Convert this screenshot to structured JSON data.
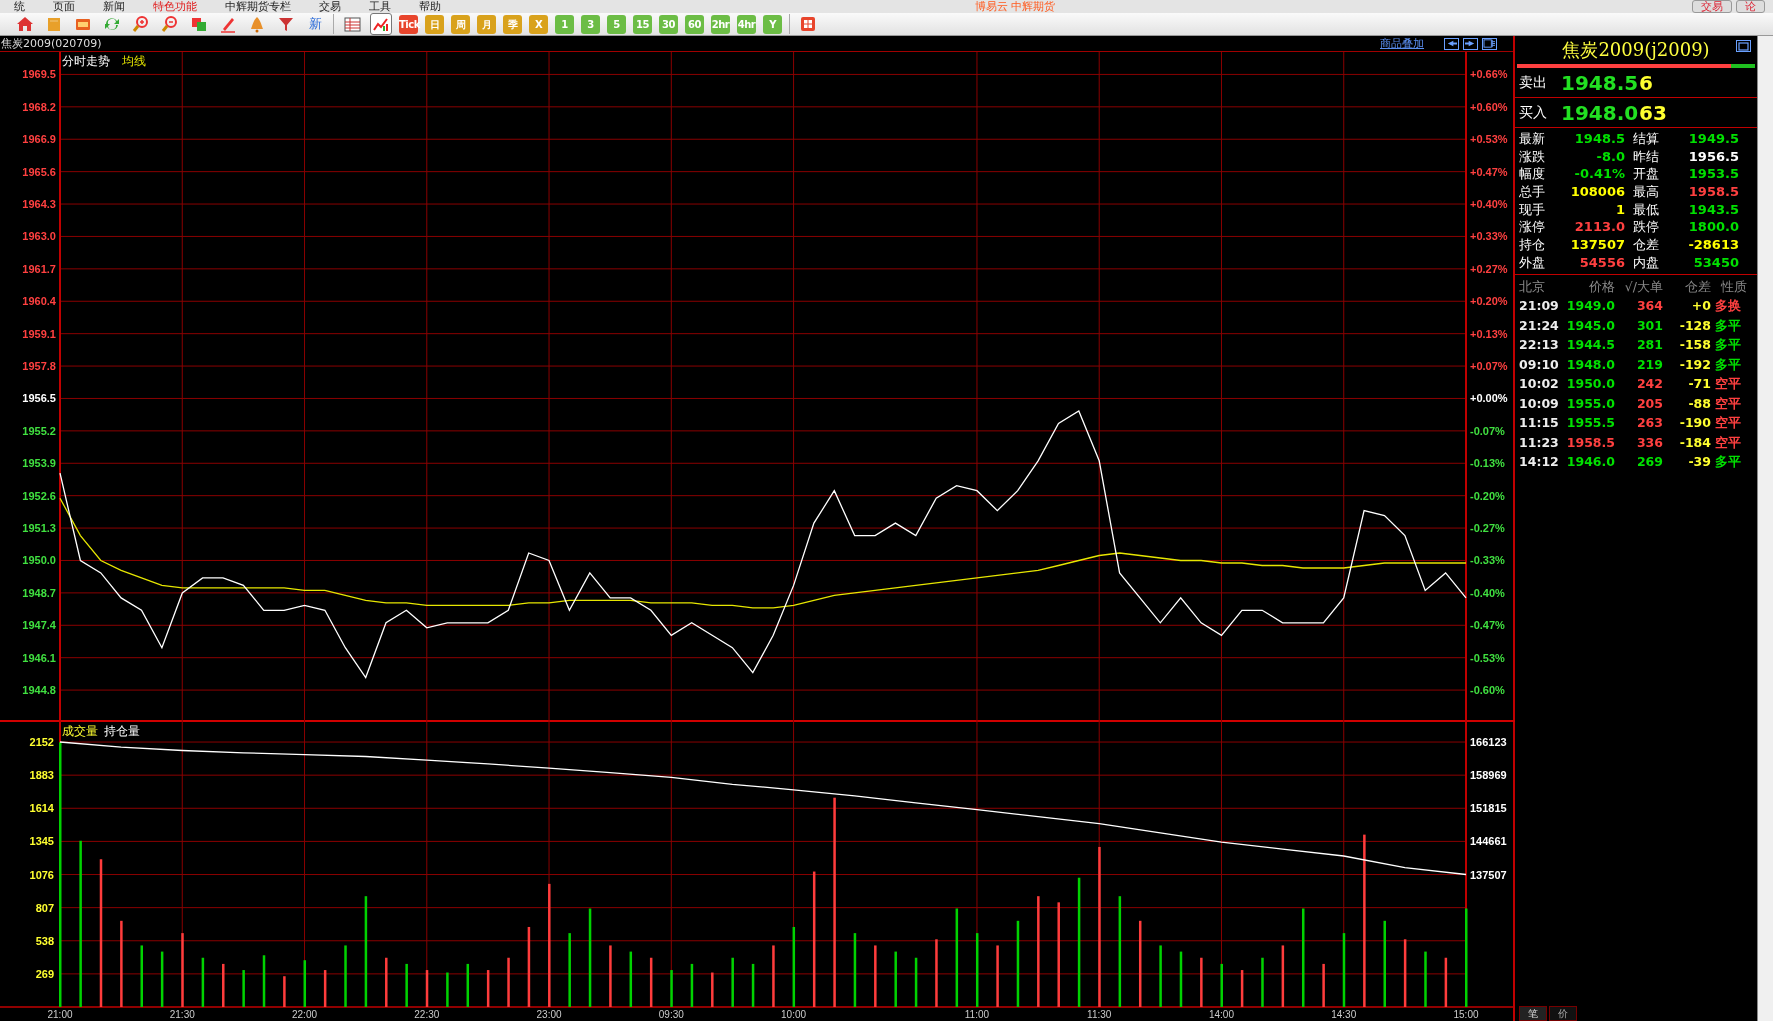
{
  "menu": {
    "items": [
      {
        "label": "统",
        "highlighted": false
      },
      {
        "label": "页面",
        "highlighted": false
      },
      {
        "label": "新闻",
        "highlighted": false
      },
      {
        "label": "特色功能",
        "highlighted": true
      },
      {
        "label": "中辉期货专栏",
        "highlighted": false
      },
      {
        "label": "交易",
        "highlighted": false
      },
      {
        "label": "工具",
        "highlighted": false
      },
      {
        "label": "帮助",
        "highlighted": false
      }
    ],
    "title": "博易云 中辉期货",
    "buttons": [
      "交易",
      "论"
    ]
  },
  "toolbar": {
    "icons": [
      {
        "selected": false
      },
      {
        "selected": false
      },
      {
        "selected": false
      },
      {
        "selected": false
      },
      {
        "selected": false
      },
      {
        "selected": false
      },
      {
        "selected": false
      },
      {
        "selected": false
      },
      {
        "selected": false
      },
      {
        "selected": false
      }
    ],
    "new_label": "新",
    "views": [
      {
        "selected": false
      },
      {
        "selected": true
      }
    ],
    "periods": [
      {
        "label": "Tick",
        "color": "#e8452c"
      },
      {
        "label": "日",
        "color": "#d9a21c"
      },
      {
        "label": "周",
        "color": "#d9a21c"
      },
      {
        "label": "月",
        "color": "#d9a21c"
      },
      {
        "label": "季",
        "color": "#d9a21c"
      },
      {
        "label": "X",
        "color": "#d9a21c"
      },
      {
        "label": "1",
        "color": "#6cbd45"
      },
      {
        "label": "3",
        "color": "#6cbd45"
      },
      {
        "label": "5",
        "color": "#6cbd45"
      },
      {
        "label": "15",
        "color": "#6cbd45"
      },
      {
        "label": "30",
        "color": "#6cbd45"
      },
      {
        "label": "60",
        "color": "#6cbd45"
      },
      {
        "label": "2hr",
        "color": "#6cbd45"
      },
      {
        "label": "4hr",
        "color": "#6cbd45"
      },
      {
        "label": "Y",
        "color": "#6cbd45"
      }
    ]
  },
  "chart_header": {
    "symbol": "焦炭2009(020709)",
    "overlay_link": "商品叠加"
  },
  "price_chart": {
    "chart_data": {
      "type": "line",
      "title": "分时走势",
      "grid": true,
      "ylim": [
        1943.6,
        1970.4
      ],
      "yticks": [
        {
          "value": 1969.5,
          "label": "1969.5"
        },
        {
          "value": 1968.2,
          "label": "1968.2"
        },
        {
          "value": 1966.9,
          "label": "1966.9"
        },
        {
          "value": 1965.6,
          "label": "1965.6"
        },
        {
          "value": 1964.3,
          "label": "1964.3"
        },
        {
          "value": 1963.0,
          "label": "1963.0"
        },
        {
          "value": 1961.7,
          "label": "1961.7"
        },
        {
          "value": 1960.4,
          "label": "1960.4"
        },
        {
          "value": 1959.1,
          "label": "1959.1"
        },
        {
          "value": 1957.8,
          "label": "1957.8"
        },
        {
          "value": 1956.5,
          "label": "1956.5"
        },
        {
          "value": 1955.2,
          "label": "1955.2"
        },
        {
          "value": 1953.9,
          "label": "1953.9"
        },
        {
          "value": 1952.6,
          "label": "1952.6"
        },
        {
          "value": 1951.3,
          "label": "1951.3"
        },
        {
          "value": 1950.0,
          "label": "1950.0"
        },
        {
          "value": 1948.7,
          "label": "1948.7"
        },
        {
          "value": 1947.4,
          "label": "1947.4"
        },
        {
          "value": 1946.1,
          "label": "1946.1"
        },
        {
          "value": 1944.8,
          "label": "1944.8"
        }
      ],
      "series": [
        {
          "color": "#ffffff",
          "values": [
            1953.5,
            1950,
            1949.5,
            1948.5,
            1948,
            1946.5,
            1948.7,
            1949.3,
            1949.3,
            1949,
            1948,
            1948,
            1948.2,
            1948,
            1946.5,
            1945.3,
            1947.5,
            1948,
            1947.3,
            1947.5,
            1947.5,
            1947.5,
            1948,
            1950.3,
            1950,
            1948,
            1949.5,
            1948.5,
            1948.5,
            1948,
            1947,
            1947.5,
            1947,
            1946.5,
            1945.5,
            1947,
            1949,
            1951.5,
            1952.8,
            1951,
            1951,
            1951.5,
            1951,
            1952.5,
            1953,
            1952.8,
            1952,
            1952.8,
            1954,
            1955.5,
            1956,
            1954,
            1949.5,
            1948.5,
            1947.5,
            1948.5,
            1947.5,
            1947,
            1948,
            1948,
            1947.5,
            1947.5,
            1947.5,
            1948.5,
            1952,
            1951.8,
            1951,
            1948.8,
            1949.5,
            1948.5
          ]
        },
        {
          "name": "均线",
          "color": "#e6e600",
          "values": [
            1952.5,
            1951,
            1950,
            1949.6,
            1949.3,
            1949,
            1948.9,
            1948.9,
            1948.9,
            1948.9,
            1948.9,
            1948.9,
            1948.8,
            1948.8,
            1948.6,
            1948.4,
            1948.3,
            1948.3,
            1948.2,
            1948.2,
            1948.2,
            1948.2,
            1948.2,
            1948.3,
            1948.3,
            1948.4,
            1948.4,
            1948.4,
            1948.4,
            1948.3,
            1948.3,
            1948.3,
            1948.2,
            1948.2,
            1948.1,
            1948.1,
            1948.2,
            1948.4,
            1948.6,
            1948.7,
            1948.8,
            1948.9,
            1949,
            1949.1,
            1949.2,
            1949.3,
            1949.4,
            1949.5,
            1949.6,
            1949.8,
            1950,
            1950.2,
            1950.3,
            1950.2,
            1950.1,
            1950,
            1950,
            1949.9,
            1949.9,
            1949.8,
            1949.8,
            1949.7,
            1949.7,
            1949.7,
            1949.8,
            1949.9,
            1949.9,
            1949.9,
            1949.9,
            1949.9
          ]
        }
      ]
    },
    "percent_ticks": [
      {
        "label": "+0.66%",
        "color": "#ff4040"
      },
      {
        "label": "+0.60%",
        "color": "#ff4040"
      },
      {
        "label": "+0.53%",
        "color": "#ff4040"
      },
      {
        "label": "+0.47%",
        "color": "#ff4040"
      },
      {
        "label": "+0.40%",
        "color": "#ff4040"
      },
      {
        "label": "+0.33%",
        "color": "#ff4040"
      },
      {
        "label": "+0.27%",
        "color": "#ff4040"
      },
      {
        "label": "+0.20%",
        "color": "#ff4040"
      },
      {
        "label": "+0.13%",
        "color": "#ff4040"
      },
      {
        "label": "+0.07%",
        "color": "#ff4040"
      },
      {
        "label": "+0.00%",
        "color": "#ffffff"
      },
      {
        "label": "-0.07%",
        "color": "#40e040"
      },
      {
        "label": "-0.13%",
        "color": "#40e040"
      },
      {
        "label": "-0.20%",
        "color": "#40e040"
      },
      {
        "label": "-0.27%",
        "color": "#40e040"
      },
      {
        "label": "-0.33%",
        "color": "#40e040"
      },
      {
        "label": "-0.40%",
        "color": "#40e040"
      },
      {
        "label": "-0.47%",
        "color": "#40e040"
      },
      {
        "label": "-0.53%",
        "color": "#40e040"
      },
      {
        "label": "-0.60%",
        "color": "#40e040"
      }
    ]
  },
  "volume_chart": {
    "chart_data": {
      "type": "bar",
      "title": "成交量",
      "grid": true,
      "ylim": [
        0,
        2331
      ],
      "yticks": [
        269,
        538,
        807,
        1076,
        1345,
        1614,
        1883,
        2152
      ],
      "categories": [
        "21:00",
        null,
        null,
        null,
        null,
        null,
        "21:30",
        null,
        null,
        null,
        null,
        null,
        "22:00",
        null,
        null,
        null,
        null,
        null,
        "22:30",
        null,
        null,
        null,
        null,
        null,
        "23:00",
        null,
        null,
        null,
        null,
        null,
        "09:30",
        null,
        null,
        null,
        null,
        null,
        "10:00",
        null,
        null,
        null,
        null,
        null,
        null,
        null,
        null,
        "11:00",
        null,
        null,
        null,
        null,
        null,
        "11:30",
        null,
        null,
        null,
        null,
        null,
        "14:00",
        null,
        null,
        null,
        null,
        null,
        "14:30",
        null,
        null,
        null,
        null,
        null,
        "15:00"
      ],
      "series": [
        {
          "color": "#ff3c3c",
          "values": [
            null,
            null,
            1200,
            700,
            null,
            null,
            600,
            null,
            350,
            null,
            null,
            250,
            null,
            300,
            null,
            null,
            400,
            null,
            300,
            null,
            null,
            300,
            400,
            650,
            1000,
            null,
            null,
            500,
            null,
            400,
            null,
            null,
            280,
            null,
            null,
            500,
            null,
            1100,
            1700,
            null,
            500,
            null,
            null,
            550,
            null,
            null,
            500,
            null,
            900,
            850,
            null,
            1300,
            null,
            700,
            null,
            null,
            400,
            null,
            300,
            null,
            500,
            null,
            350,
            null,
            1400,
            null,
            550,
            null,
            400,
            null
          ]
        },
        {
          "color": "#00d200",
          "values": [
            2150,
            1350,
            null,
            null,
            500,
            450,
            null,
            400,
            null,
            300,
            420,
            null,
            380,
            null,
            500,
            900,
            null,
            350,
            null,
            280,
            350,
            null,
            null,
            null,
            null,
            600,
            800,
            null,
            450,
            null,
            300,
            350,
            null,
            400,
            350,
            null,
            650,
            null,
            null,
            600,
            null,
            450,
            400,
            null,
            800,
            600,
            null,
            700,
            null,
            null,
            1050,
            null,
            900,
            null,
            500,
            450,
            null,
            350,
            null,
            400,
            null,
            800,
            null,
            600,
            null,
            700,
            null,
            450,
            null,
            800
          ]
        }
      ]
    }
  },
  "open_interest_chart": {
    "chart_data": {
      "type": "line",
      "title": "持仓量",
      "ylim": [
        137507,
        166123
      ],
      "yticks": [
        137507,
        144661,
        151815,
        158969,
        166123
      ],
      "series": [
        {
          "color": "#ffffff",
          "values": [
            166123,
            165000,
            164300,
            163800,
            163400,
            163000,
            162200,
            161400,
            160500,
            159500,
            158500,
            157000,
            155800,
            154500,
            153000,
            151500,
            150000,
            148500,
            146500,
            144500,
            143000,
            141500,
            139000,
            137507
          ]
        }
      ]
    }
  },
  "quote_panel": {
    "title": "焦炭2009(j2009)",
    "ratio_bar": {
      "level": 0.9
    },
    "ask": {
      "label": "卖出",
      "price": "1948.5",
      "volume": "6"
    },
    "bid": {
      "label": "买入",
      "price": "1948.0",
      "volume": "63"
    },
    "stats": [
      {
        "label": "最新",
        "value": "1948.5",
        "color": "#00e000"
      },
      {
        "label": "结算",
        "value": "1949.5",
        "color": "#00e000"
      },
      {
        "label": "涨跌",
        "value": "-8.0",
        "color": "#00e000"
      },
      {
        "label": "昨结",
        "value": "1956.5",
        "color": "#ffffff"
      },
      {
        "label": "幅度",
        "value": "-0.41%",
        "color": "#00e000"
      },
      {
        "label": "开盘",
        "value": "1953.5",
        "color": "#00e000"
      },
      {
        "label": "总手",
        "value": "108006",
        "color": "#ffff00"
      },
      {
        "label": "最高",
        "value": "1958.5",
        "color": "#ff4040"
      },
      {
        "label": "现手",
        "value": "1",
        "color": "#ffff00"
      },
      {
        "label": "最低",
        "value": "1943.5",
        "color": "#00e000"
      },
      {
        "label": "涨停",
        "value": "2113.0",
        "color": "#ff4040"
      },
      {
        "label": "跌停",
        "value": "1800.0",
        "color": "#00e000"
      },
      {
        "label": "持仓",
        "value": "137507",
        "color": "#ffff00"
      },
      {
        "label": "仓差",
        "value": "-28613",
        "color": "#ffff00"
      },
      {
        "label": "外盘",
        "value": "54556",
        "color": "#ff4040"
      },
      {
        "label": "内盘",
        "value": "53450",
        "color": "#00e000"
      }
    ],
    "ticks_columns": [
      "北京",
      "价格",
      "√/大单",
      "仓差",
      "性质"
    ],
    "ticks": [
      {
        "time": "21:09",
        "price": {
          "text": "1949.0",
          "color": "#00e000"
        },
        "volume": {
          "text": "364",
          "color": "#ff4040"
        },
        "oi_change": "+0",
        "nature": {
          "text": "多换",
          "color": "#ff4040"
        }
      },
      {
        "time": "21:24",
        "price": {
          "text": "1945.0",
          "color": "#00e000"
        },
        "volume": {
          "text": "301",
          "color": "#00e000"
        },
        "oi_change": "-128",
        "nature": {
          "text": "多平",
          "color": "#00e000"
        }
      },
      {
        "time": "22:13",
        "price": {
          "text": "1944.5",
          "color": "#00e000"
        },
        "volume": {
          "text": "281",
          "color": "#00e000"
        },
        "oi_change": "-158",
        "nature": {
          "text": "多平",
          "color": "#00e000"
        }
      },
      {
        "time": "09:10",
        "price": {
          "text": "1948.0",
          "color": "#00e000"
        },
        "volume": {
          "text": "219",
          "color": "#00e000"
        },
        "oi_change": "-192",
        "nature": {
          "text": "多平",
          "color": "#00e000"
        }
      },
      {
        "time": "10:02",
        "price": {
          "text": "1950.0",
          "color": "#00e000"
        },
        "volume": {
          "text": "242",
          "color": "#ff4040"
        },
        "oi_change": "-71",
        "nature": {
          "text": "空平",
          "color": "#ff4040"
        }
      },
      {
        "time": "10:09",
        "price": {
          "text": "1955.0",
          "color": "#00e000"
        },
        "volume": {
          "text": "205",
          "color": "#ff4040"
        },
        "oi_change": "-88",
        "nature": {
          "text": "空平",
          "color": "#ff4040"
        }
      },
      {
        "time": "11:15",
        "price": {
          "text": "1955.5",
          "color": "#00e000"
        },
        "volume": {
          "text": "263",
          "color": "#ff4040"
        },
        "oi_change": "-190",
        "nature": {
          "text": "空平",
          "color": "#ff4040"
        }
      },
      {
        "time": "11:23",
        "price": {
          "text": "1958.5",
          "color": "#ff4040"
        },
        "volume": {
          "text": "336",
          "color": "#ff4040"
        },
        "oi_change": "-184",
        "nature": {
          "text": "空平",
          "color": "#ff4040"
        }
      },
      {
        "time": "14:12",
        "price": {
          "text": "1946.0",
          "color": "#00e000"
        },
        "volume": {
          "text": "269",
          "color": "#00e000"
        },
        "oi_change": "-39",
        "nature": {
          "text": "多平",
          "color": "#00e000"
        }
      }
    ],
    "bottom_tabs": [
      {
        "label": "笔",
        "selected": true
      },
      {
        "label": "价",
        "selected": false
      }
    ]
  }
}
